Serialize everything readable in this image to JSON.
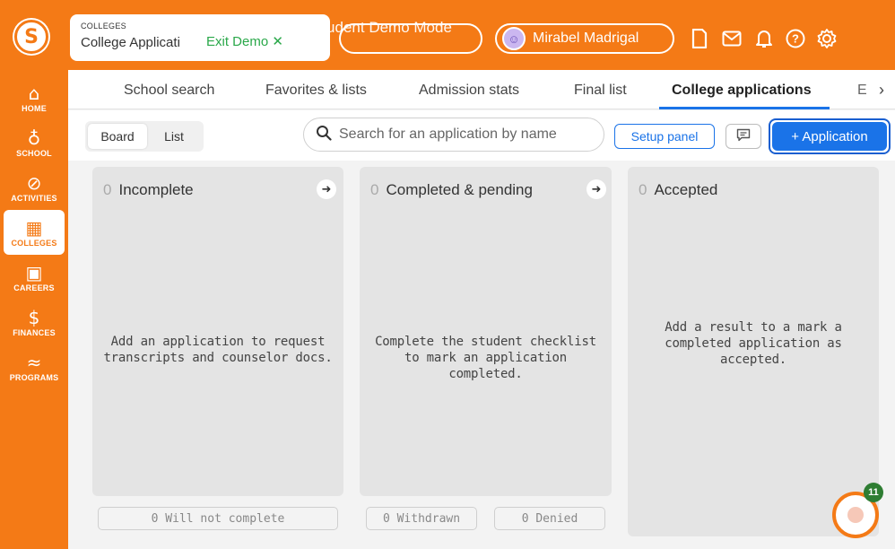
{
  "app": {
    "logo_letter": "S"
  },
  "header": {
    "section_label": "COLLEGES",
    "page_title": "College Applicati",
    "exit_demo": "Exit Demo ✕",
    "student_mode": "Student Demo Mode",
    "student_name": "Mirabel Madrigal",
    "icons": [
      "document-icon",
      "mail-icon",
      "bell-icon",
      "help-icon",
      "gear-icon"
    ]
  },
  "sidebar": {
    "items": [
      {
        "label": "HOME",
        "icon": "⌂"
      },
      {
        "label": "SCHOOL",
        "icon": "♁"
      },
      {
        "label": "ACTIVITIES",
        "icon": "⊘"
      },
      {
        "label": "COLLEGES",
        "icon": "▦"
      },
      {
        "label": "CAREERS",
        "icon": "▣"
      },
      {
        "label": "FINANCES",
        "icon": "$"
      },
      {
        "label": "PROGRAMS",
        "icon": "≈"
      }
    ]
  },
  "tabs": {
    "items": [
      "School search",
      "Favorites & lists",
      "Admission stats",
      "Final list",
      "College applications"
    ],
    "more": "E",
    "next": "›",
    "active": "College applications"
  },
  "toolbar": {
    "board": "Board",
    "list": "List",
    "search_placeholder": "Search for an application by name",
    "setup_panel": "Setup panel",
    "add_application": "+ Application"
  },
  "board": {
    "columns": [
      {
        "count": "0",
        "title": "Incomplete",
        "message": "Add an application to request transcripts and counselor docs."
      },
      {
        "count": "0",
        "title": "Completed & pending",
        "message": "Complete the student checklist to mark an application completed."
      },
      {
        "count": "0",
        "title": "Accepted",
        "message": "Add a result to a mark a completed application as accepted."
      }
    ],
    "footers": {
      "will_not_complete": "0 Will not complete",
      "withdrawn": "0 Withdrawn",
      "denied": "0 Denied"
    }
  },
  "chat": {
    "badge": "11"
  },
  "colors": {
    "brand": "#f47a16",
    "accent": "#1a73e8",
    "column_bg": "#e4e4e4"
  }
}
